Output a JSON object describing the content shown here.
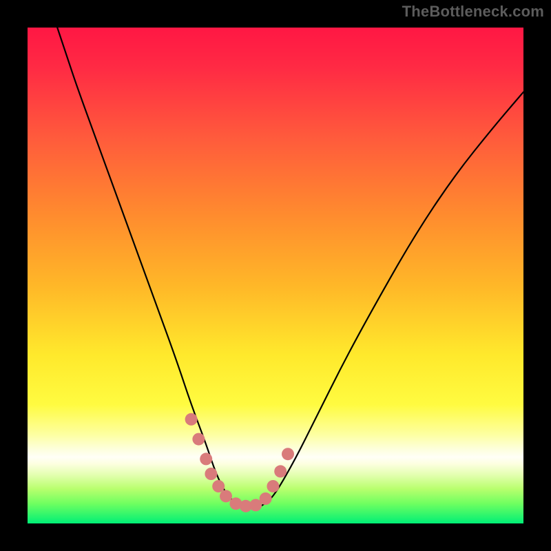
{
  "watermark": {
    "text": "TheBottleneck.com"
  },
  "chart_data": {
    "type": "line",
    "title": "",
    "xlabel": "",
    "ylabel": "",
    "xlim": [
      0,
      100
    ],
    "ylim": [
      0,
      100
    ],
    "series": [
      {
        "name": "bottleneck-curve",
        "x": [
          6,
          8,
          10,
          14,
          18,
          22,
          26,
          30,
          33,
          36,
          38,
          40,
          42,
          44,
          46,
          48,
          50,
          54,
          58,
          64,
          70,
          78,
          86,
          94,
          100
        ],
        "y": [
          100,
          94,
          88,
          77,
          66,
          55,
          44,
          33,
          24,
          16,
          10,
          6,
          4,
          3,
          3,
          4,
          6,
          13,
          21,
          33,
          44,
          58,
          70,
          80,
          87
        ]
      }
    ],
    "markers": {
      "name": "highlight-dots",
      "color": "#d97b7b",
      "points": [
        {
          "x": 33.0,
          "y": 21
        },
        {
          "x": 34.5,
          "y": 17
        },
        {
          "x": 36.0,
          "y": 13
        },
        {
          "x": 37.0,
          "y": 10
        },
        {
          "x": 38.5,
          "y": 7.5
        },
        {
          "x": 40.0,
          "y": 5.5
        },
        {
          "x": 42.0,
          "y": 4.0
        },
        {
          "x": 44.0,
          "y": 3.5
        },
        {
          "x": 46.0,
          "y": 3.7
        },
        {
          "x": 48.0,
          "y": 5.0
        },
        {
          "x": 49.5,
          "y": 7.5
        },
        {
          "x": 51.0,
          "y": 10.5
        },
        {
          "x": 52.5,
          "y": 14.0
        }
      ]
    }
  }
}
